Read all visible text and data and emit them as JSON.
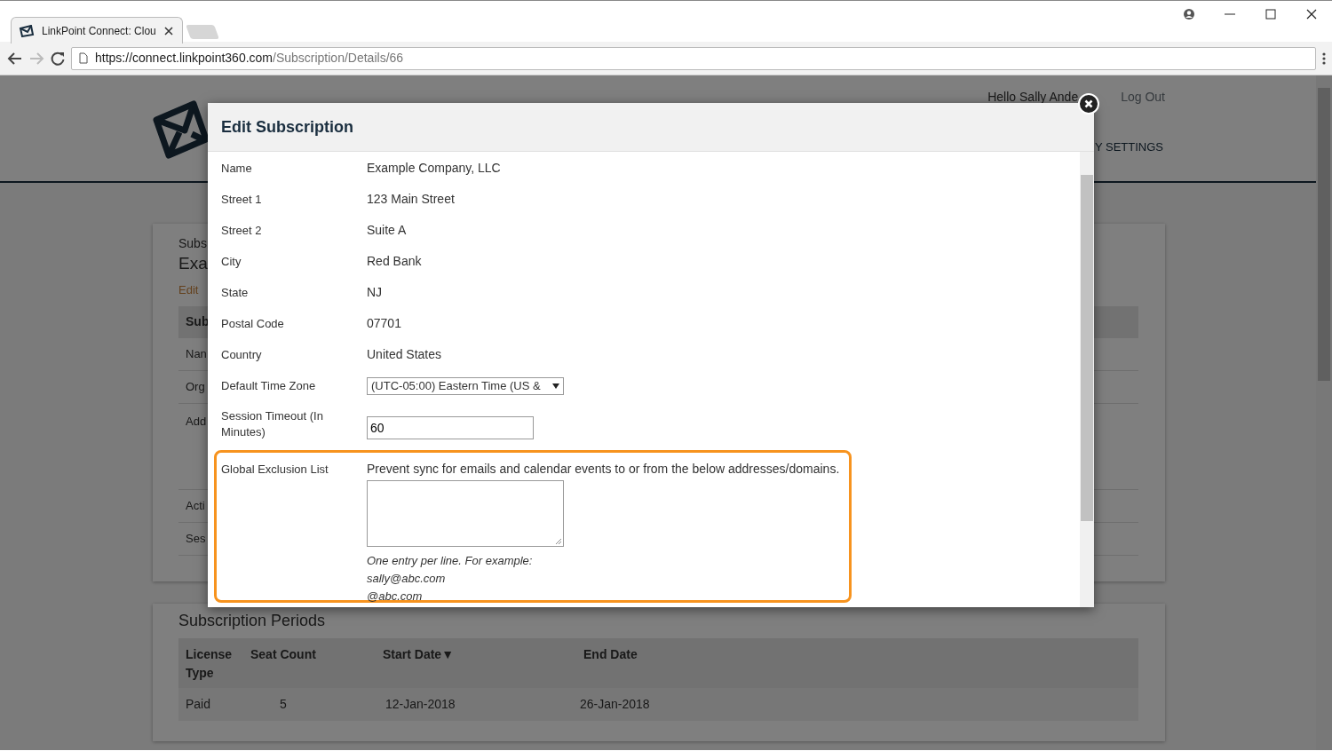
{
  "browser": {
    "tab": {
      "title": "LinkPoint Connect: Clou",
      "selected": true
    },
    "url": {
      "host": "https://connect.linkpoint360.com",
      "path": "/Subscription/Details/66"
    }
  },
  "page": {
    "greeting": "Hello Sally Ande",
    "logout": "Log Out",
    "nav_item": "Y SETTINGS",
    "details_card": {
      "caption": "Subs",
      "title": "Exa",
      "link": "Edit",
      "table_header": "Sub",
      "rows": [
        {
          "label": "Nan",
          "tall": false
        },
        {
          "label": "Org",
          "tall": false
        },
        {
          "label": "Add",
          "tall": true
        },
        {
          "label": "Acti",
          "tall": false
        },
        {
          "label": "Ses",
          "tall": false
        }
      ]
    },
    "periods": {
      "title": "Subscription Periods",
      "columns": [
        {
          "label": "License Type"
        },
        {
          "label": "Seat Count"
        },
        {
          "label": "Start Date",
          "sort_indicator": "▼"
        },
        {
          "label": "End Date"
        }
      ],
      "rows": [
        [
          "Paid",
          "5",
          "12-Jan-2018",
          "26-Jan-2018"
        ]
      ]
    }
  },
  "modal": {
    "title": "Edit Subscription",
    "fields": [
      {
        "kind": "text",
        "label": "Name",
        "value": "Example Company, LLC"
      },
      {
        "kind": "text",
        "label": "Street 1",
        "value": "123 Main Street"
      },
      {
        "kind": "text",
        "label": "Street 2",
        "value": "Suite A"
      },
      {
        "kind": "text",
        "label": "City",
        "value": "Red Bank"
      },
      {
        "kind": "text",
        "label": "State",
        "value": "NJ"
      },
      {
        "kind": "text",
        "label": "Postal Code",
        "value": "07701"
      },
      {
        "kind": "text",
        "label": "Country",
        "value": "United States"
      },
      {
        "kind": "select",
        "label": "Default Time Zone",
        "value": "(UTC-05:00) Eastern Time (US &"
      },
      {
        "kind": "input",
        "label": "Session Timeout (In Minutes)",
        "value": "60"
      },
      {
        "kind": "textarea",
        "label": "Global Exclusion List",
        "description": "Prevent sync for emails and calendar events to or from the below addresses/domains.",
        "help": [
          "One entry per line. For example:",
          "sally@abc.com",
          "@abc.com"
        ],
        "highlighted": true
      }
    ]
  }
}
